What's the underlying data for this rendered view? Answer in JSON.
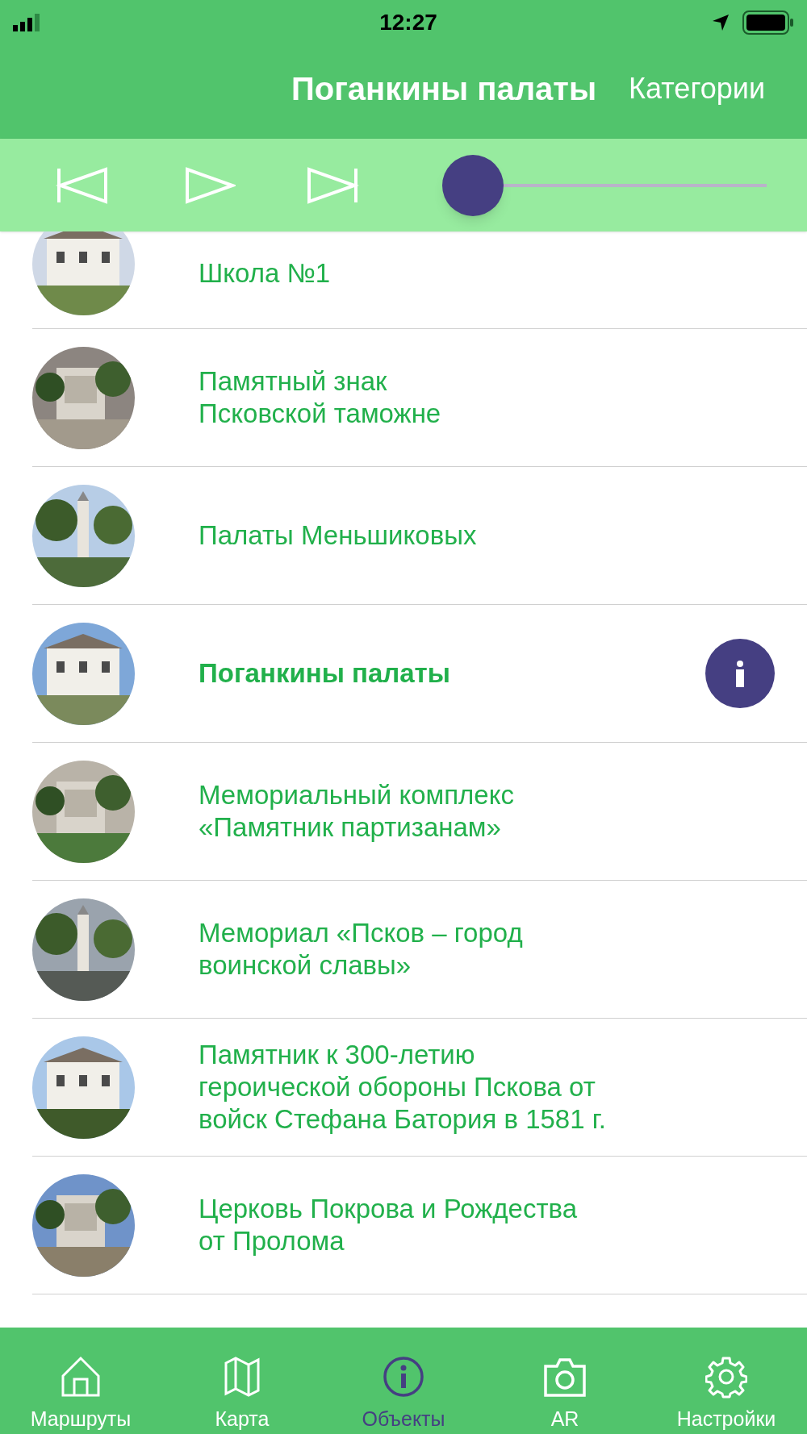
{
  "status_bar": {
    "time": "12:27"
  },
  "nav_bar": {
    "title": "Поганкины палаты",
    "right_button": "Категории"
  },
  "player": {
    "level": 0
  },
  "items": [
    {
      "title": "Школа №1",
      "selected": false,
      "clipped": true
    },
    {
      "title": "Памятный знак\nПсковской таможне",
      "selected": false
    },
    {
      "title": "Палаты Меньшиковых",
      "selected": false
    },
    {
      "title": "Поганкины палаты",
      "selected": true
    },
    {
      "title": "Мемориальный комплекс\n«Памятник партизанам»",
      "selected": false
    },
    {
      "title": "Мемориал «Псков – город\nвоинской славы»",
      "selected": false
    },
    {
      "title": "Памятник к 300-летию\nгероической обороны Пскова от\nвойск Стефана Батория в 1581 г.",
      "selected": false
    },
    {
      "title": "Церковь Покрова и Рождества\nот Пролома",
      "selected": false
    }
  ],
  "tabs": [
    {
      "label": "Маршруты",
      "kind": "home",
      "selected": false
    },
    {
      "label": "Карта",
      "kind": "map",
      "selected": false
    },
    {
      "label": "Объекты",
      "kind": "info",
      "selected": true
    },
    {
      "label": "AR",
      "kind": "camera",
      "selected": false
    },
    {
      "label": "Настройки",
      "kind": "settings",
      "selected": false
    }
  ]
}
